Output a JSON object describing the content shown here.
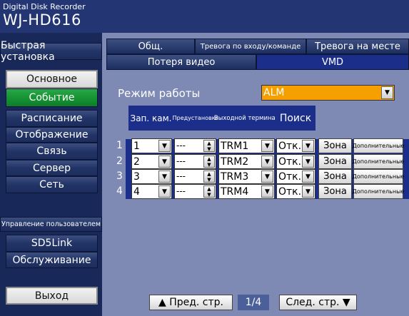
{
  "header": {
    "brand": "Digital Disk Recorder",
    "model": "WJ-HD616"
  },
  "sidebar": {
    "quick": "Быстрая установка",
    "items": [
      "Основное",
      "Событие",
      "Расписание",
      "Отображение",
      "Связь",
      "Сервер",
      "Сеть",
      "Управление пользователем",
      "SD5Link",
      "Обслуживание"
    ],
    "active": "Событие",
    "exit": "Выход"
  },
  "tabs": {
    "row1": [
      "Общ.",
      "Тревога по входу/команде",
      "Тревога на месте"
    ],
    "row2": [
      "Потеря видео",
      "VMD"
    ],
    "active": "VMD"
  },
  "mode": {
    "label": "Режим работы",
    "value": "ALM"
  },
  "table": {
    "headers": [
      "Зап. кам.",
      "Предустановка",
      "Выходной терминал",
      "Поиск"
    ],
    "rows": [
      {
        "num": "1",
        "camera": "1",
        "preset": "---",
        "terminal": "TRM1",
        "search": "Отк.",
        "zone": "Зона",
        "more": "Дополнительные"
      },
      {
        "num": "2",
        "camera": "2",
        "preset": "---",
        "terminal": "TRM2",
        "search": "Отк.",
        "zone": "Зона",
        "more": "Дополнительные"
      },
      {
        "num": "3",
        "camera": "3",
        "preset": "---",
        "terminal": "TRM3",
        "search": "Отк.",
        "zone": "Зона",
        "more": "Дополнительные"
      },
      {
        "num": "4",
        "camera": "4",
        "preset": "---",
        "terminal": "TRM4",
        "search": "Отк.",
        "zone": "Зона",
        "more": "Дополнительные"
      }
    ]
  },
  "pager": {
    "prev": "▲ Пред. стр.",
    "page": "1/4",
    "next": "След. стр. ▼"
  },
  "icons": {
    "dropdown": "triangle-down",
    "stepper": "up-down-arrows"
  },
  "colors": {
    "active_green": "#169434",
    "mode_orange": "#f5a000",
    "panel": "#7e8ab3",
    "header_blue": "#1b2f8a"
  }
}
